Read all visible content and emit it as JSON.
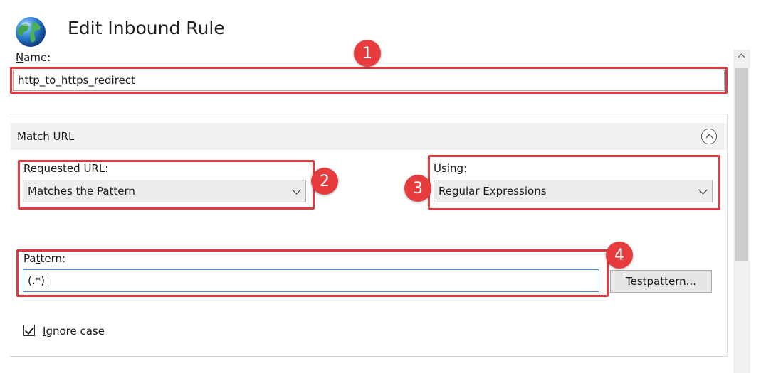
{
  "header": {
    "title": "Edit Inbound Rule",
    "icon": "globe-icon"
  },
  "name_field": {
    "label_underlined": "N",
    "label_rest": "ame:",
    "value": "http_to_https_redirect"
  },
  "match_url": {
    "section_title": "Match URL",
    "requested_url": {
      "label_underlined": "R",
      "label_rest": "equested URL:",
      "selected": "Matches the Pattern"
    },
    "using": {
      "label_pre": "U",
      "label_underlined": "s",
      "label_rest": "ing:",
      "selected": "Regular Expressions"
    },
    "pattern": {
      "label_pre": "Pa",
      "label_underlined": "t",
      "label_rest": "tern:",
      "value": "(.*)"
    },
    "test_pattern": {
      "pre": "Test ",
      "underlined": "p",
      "rest": "attern..."
    },
    "ignore_case": {
      "checked": true,
      "label_underlined": "I",
      "label_rest": "gnore case"
    }
  },
  "annotations": [
    "1",
    "2",
    "3",
    "4"
  ],
  "colors": {
    "highlight": "#e03a3e",
    "badge": "#e63c3d",
    "focus_border": "#3c8fd6"
  }
}
